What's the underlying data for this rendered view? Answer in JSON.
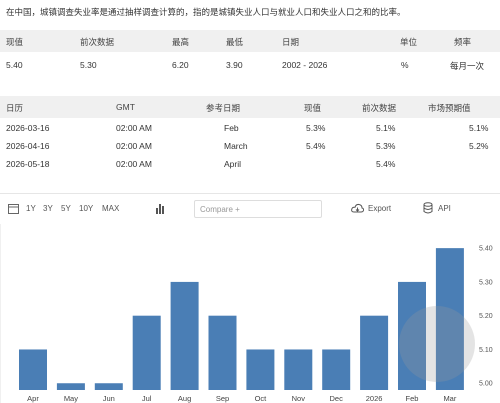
{
  "description": "在中国，城镇调查失业率是通过抽样调查计算的，指的是城镇失业人口与就业人口和失业人口之和的比率。",
  "summary": {
    "headers": [
      "现值",
      "前次数据",
      "最高",
      "最低",
      "日期",
      "单位",
      "频率"
    ],
    "values": [
      "5.40",
      "5.30",
      "6.20",
      "3.90",
      "2002 - 2026",
      "%",
      "每月一次"
    ]
  },
  "calendar": {
    "headers": [
      "日历",
      "GMT",
      "参考日期",
      "现值",
      "前次数据",
      "市场预期值"
    ],
    "rows": [
      [
        "2026-03-16",
        "02:00 AM",
        "Feb",
        "5.3%",
        "5.1%",
        "5.1%"
      ],
      [
        "2026-04-16",
        "02:00 AM",
        "March",
        "5.4%",
        "5.3%",
        "5.2%"
      ],
      [
        "2026-05-18",
        "02:00 AM",
        "April",
        "",
        "5.4%",
        ""
      ]
    ]
  },
  "toolbar": {
    "ranges": [
      "1Y",
      "3Y",
      "5Y",
      "10Y",
      "MAX"
    ],
    "compare_placeholder": "Compare +",
    "export_label": "Export",
    "api_label": "API"
  },
  "watermark": {
    "line1": "麻辣",
    "line2": "mala.cn"
  },
  "colors": {
    "bar": "#4a7eb5",
    "header_bg": "#f0f0f0"
  },
  "chart_data": {
    "type": "bar",
    "categories": [
      "Apr",
      "May",
      "Jun",
      "Jul",
      "Aug",
      "Sep",
      "Oct",
      "Nov",
      "Dec",
      "2026",
      "Feb",
      "Mar"
    ],
    "values": [
      5.1,
      5.0,
      5.0,
      5.2,
      5.3,
      5.2,
      5.1,
      5.1,
      5.1,
      5.2,
      5.3,
      5.4
    ],
    "yticks": [
      "5.00",
      "5.10",
      "5.20",
      "5.30",
      "5.40"
    ],
    "ylim": [
      4.98,
      5.43
    ]
  }
}
